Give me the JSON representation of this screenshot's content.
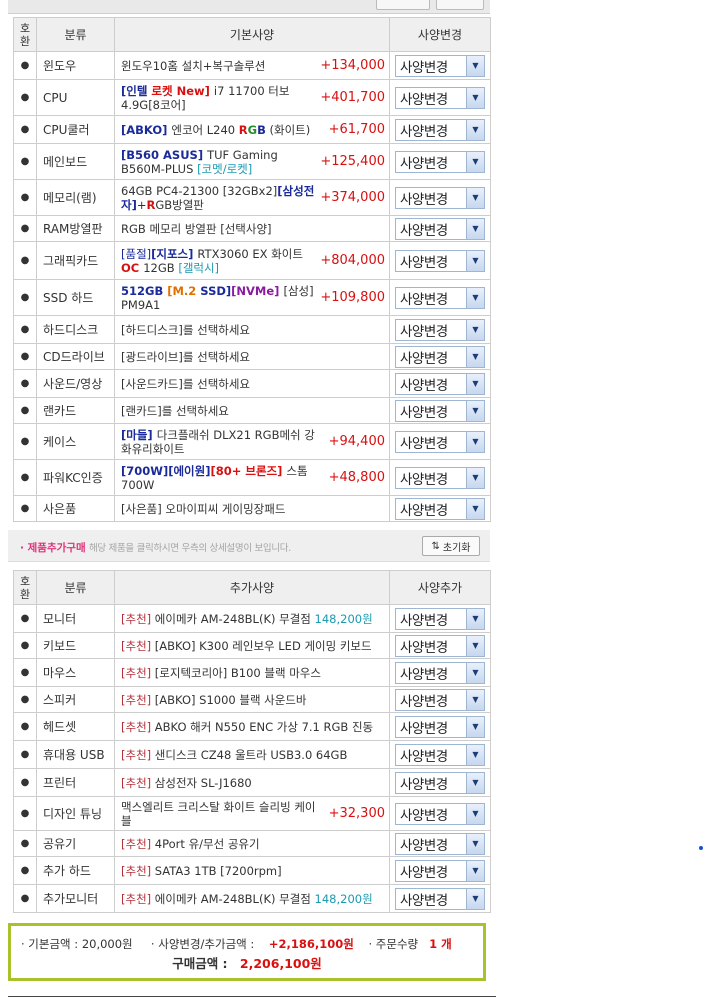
{
  "controls": {
    "dot": "●",
    "select_arrow": "▼",
    "reset_icon": "⇅"
  },
  "spec_table": {
    "headers": {
      "col1": "호환",
      "col2": "분류",
      "col3": "기본사양",
      "col4": "사양변경"
    },
    "select_label": "사양변경",
    "rows": [
      {
        "cat": "윈도우",
        "parts": [
          [
            "윈도우10홈 설치+복구솔루션",
            ""
          ]
        ],
        "price": "+134,000"
      },
      {
        "cat": "CPU",
        "parts": [
          [
            "[인텔 ",
            "blue"
          ],
          [
            "로켓 ",
            "red"
          ],
          [
            "New] ",
            "red"
          ],
          [
            "i7 11700 터보4.9G[8코어]",
            ""
          ]
        ],
        "price": "+401,700"
      },
      {
        "cat": "CPU쿨러",
        "parts": [
          [
            "[ABKO] ",
            "blue"
          ],
          [
            "엔코어 L240 ",
            ""
          ],
          [
            "R",
            "red"
          ],
          [
            "G",
            "green"
          ],
          [
            "B",
            "blue"
          ],
          [
            " (화이트)",
            ""
          ]
        ],
        "price": "+61,700"
      },
      {
        "cat": "메인보드",
        "parts": [
          [
            "[B560 ASUS] ",
            "blue"
          ],
          [
            "TUF Gaming B560M-PLUS ",
            ""
          ],
          [
            "[코멧/로켓]",
            "teal"
          ]
        ],
        "price": "+125,400"
      },
      {
        "cat": "메모리(램)",
        "parts": [
          [
            "64GB PC4-21300 [32GBx2]",
            ""
          ],
          [
            "[삼성전자]",
            "blue"
          ],
          [
            "+",
            ""
          ],
          [
            "R",
            "red"
          ],
          [
            "GB방열판",
            ""
          ]
        ],
        "price": "+374,000"
      },
      {
        "cat": "RAM방열판",
        "parts": [
          [
            "RGB 메모리 방열판 [선택사양]",
            ""
          ]
        ],
        "price": ""
      },
      {
        "cat": "그래픽카드",
        "parts": [
          [
            "[품절]",
            "navy"
          ],
          [
            "[지포스] ",
            "blue"
          ],
          [
            "RTX3060 EX 화이트 ",
            ""
          ],
          [
            "OC ",
            "red"
          ],
          [
            "12GB ",
            ""
          ],
          [
            "[갤럭시]",
            "teal"
          ]
        ],
        "price": "+804,000"
      },
      {
        "cat": "SSD 하드",
        "parts": [
          [
            "512GB ",
            "blue"
          ],
          [
            "[M.2 ",
            "orange"
          ],
          [
            "SSD]",
            "blue"
          ],
          [
            "[NVMe] ",
            "purple"
          ],
          [
            "[삼성] PM9A1",
            ""
          ]
        ],
        "price": "+109,800"
      },
      {
        "cat": "하드디스크",
        "parts": [
          [
            "[하드디스크]를 선택하세요",
            ""
          ]
        ],
        "price": ""
      },
      {
        "cat": "CD드라이브",
        "parts": [
          [
            "[광드라이브]를 선택하세요",
            ""
          ]
        ],
        "price": ""
      },
      {
        "cat": "사운드/영상",
        "parts": [
          [
            "[사운드카드]를 선택하세요",
            ""
          ]
        ],
        "price": ""
      },
      {
        "cat": "랜카드",
        "parts": [
          [
            "[랜카드]를 선택하세요",
            ""
          ]
        ],
        "price": ""
      },
      {
        "cat": "케이스",
        "parts": [
          [
            "[마들] ",
            "blue"
          ],
          [
            "다크플래쉬 DLX21 RGB메쉬 강화유리화이트",
            ""
          ]
        ],
        "price": "+94,400"
      },
      {
        "cat": "파워KC인증",
        "parts": [
          [
            "[700W]",
            "blue"
          ],
          [
            "[에이원]",
            "blue"
          ],
          [
            "[80+ 브론즈] ",
            "red"
          ],
          [
            "스톰 700W",
            ""
          ]
        ],
        "price": "+48,800"
      },
      {
        "cat": "사은품",
        "parts": [
          [
            "[사은품] 오마이피씨 게이밍장패드",
            ""
          ]
        ],
        "price": ""
      }
    ]
  },
  "add_bar": {
    "title": "· 제품추가구매",
    "hint": "해당 제품을 클릭하시면 우측의 상세설명이 보입니다.",
    "reset_label": "초기화"
  },
  "add_table": {
    "headers": {
      "col1": "호환",
      "col2": "분류",
      "col3": "추가사양",
      "col4": "사양추가"
    },
    "select_label": "사양변경",
    "rows": [
      {
        "cat": "모니터",
        "parts": [
          [
            "[추천] ",
            "rec"
          ],
          [
            "에이메카 AM-248BL(K) 무결점 ",
            ""
          ],
          [
            "148,200원",
            "teal"
          ]
        ],
        "price": ""
      },
      {
        "cat": "키보드",
        "parts": [
          [
            "[추천] ",
            "rec"
          ],
          [
            "[ABKO] K300 레인보우 LED 게이밍 키보드",
            ""
          ]
        ],
        "price": ""
      },
      {
        "cat": "마우스",
        "parts": [
          [
            "[추천] ",
            "rec"
          ],
          [
            "[로지텍코리아] B100 블랙 마우스",
            ""
          ]
        ],
        "price": ""
      },
      {
        "cat": "스피커",
        "parts": [
          [
            "[추천] ",
            "rec"
          ],
          [
            "[ABKO] S1000 블랙 사운드바",
            ""
          ]
        ],
        "price": ""
      },
      {
        "cat": "헤드셋",
        "parts": [
          [
            "[추천] ",
            "rec"
          ],
          [
            "ABKO 해커 N550 ENC 가상 7.1 RGB 진동",
            ""
          ]
        ],
        "price": ""
      },
      {
        "cat": "휴대용 USB",
        "parts": [
          [
            "[추천] ",
            "rec"
          ],
          [
            "샌디스크 CZ48 울트라 USB3.0 64GB",
            ""
          ]
        ],
        "price": ""
      },
      {
        "cat": "프린터",
        "parts": [
          [
            "[추천] ",
            "rec"
          ],
          [
            "삼성전자 SL-J1680",
            ""
          ]
        ],
        "price": ""
      },
      {
        "cat": "디자인 튜닝",
        "parts": [
          [
            "맥스엘리트 크리스탈 화이트 슬리빙 케이블",
            ""
          ]
        ],
        "price": "+32,300"
      },
      {
        "cat": "공유기",
        "parts": [
          [
            "[추천] ",
            "rec"
          ],
          [
            "4Port 유/무선 공유기",
            ""
          ]
        ],
        "price": ""
      },
      {
        "cat": "추가 하드",
        "parts": [
          [
            "[추천] ",
            "rec"
          ],
          [
            "SATA3 1TB [7200rpm]",
            ""
          ]
        ],
        "price": ""
      },
      {
        "cat": "추가모니터",
        "parts": [
          [
            "[추천] ",
            "rec"
          ],
          [
            "에이메카 AM-248BL(K) 무결점 ",
            ""
          ],
          [
            "148,200원",
            "teal"
          ]
        ],
        "price": ""
      }
    ]
  },
  "summary": {
    "base_label": "· 기본금액 : 20,000원",
    "change_label": "· 사양변경/추가금액 :",
    "change_value": "+2,186,100원",
    "qty_label": "· 주문수량",
    "qty_value": "1 개",
    "total_label": "구매금액 :",
    "total_value": "2,206,100원"
  }
}
